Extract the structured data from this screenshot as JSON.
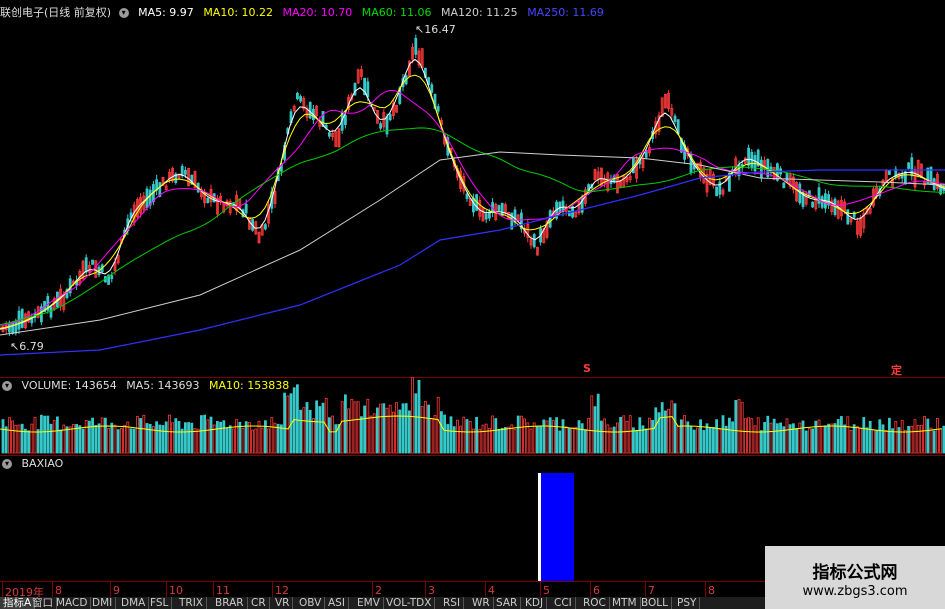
{
  "main": {
    "title": "联创电子(日线 前复权)",
    "ma5": "MA5: 9.97",
    "ma10": "MA10: 10.22",
    "ma20": "MA20: 10.70",
    "ma60": "MA60: 11.06",
    "ma120": "MA120: 11.25",
    "ma250": "MA250: 11.69",
    "high_label": "16.47",
    "low_label": "6.79",
    "marker_s": "S",
    "marker_ding": "定"
  },
  "volume": {
    "label": "VOLUME: 143654",
    "ma5": "MA5: 143693",
    "ma10": "MA10: 153838"
  },
  "indicator": {
    "label": "BAXIAO"
  },
  "axis": {
    "ticks": [
      "2019年",
      "8",
      "9",
      "10",
      "11",
      "12",
      "2",
      "3",
      "4",
      "5",
      "6",
      "7",
      "8"
    ]
  },
  "tabs": [
    "指标A",
    "窗口",
    "MACD",
    "DMI",
    "DMA",
    "FSL",
    "TRIX",
    "BRAR",
    "CR",
    "VR",
    "OBV",
    "ASI",
    "EMV",
    "VOL-TDX",
    "RSI",
    "WR",
    "SAR",
    "KDJ",
    "CCI",
    "ROC",
    "MTM",
    "BOLL",
    "PSY"
  ],
  "watermark": {
    "line1": "指标公式网",
    "line2": "www.zbgs3.com"
  },
  "colors": {
    "up": "#ff3b3b",
    "down": "#36c9c9",
    "ma5": "#ffffff",
    "ma10": "#ffff00",
    "ma20": "#ff00ff",
    "ma60": "#00cc00",
    "ma120": "#cfcfcf",
    "ma250": "#3030ff",
    "indicator_bar": "#0000ff"
  }
}
